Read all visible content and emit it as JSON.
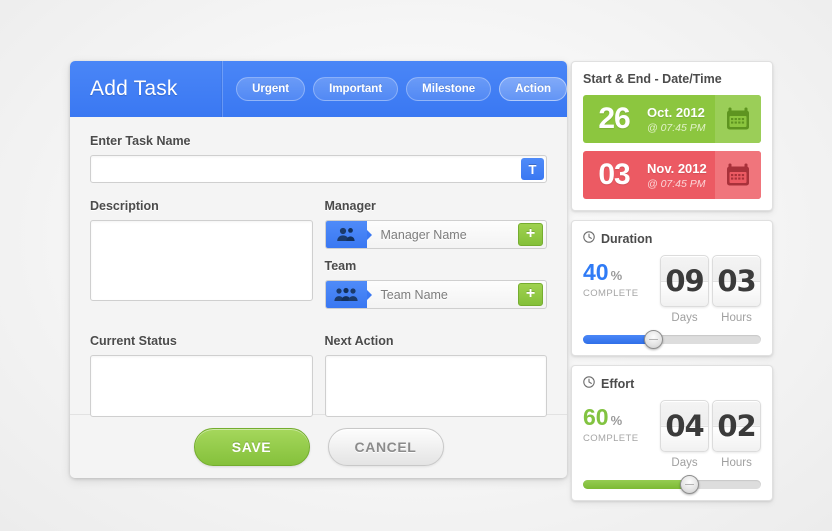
{
  "window": {
    "title": "Add Task",
    "tags": [
      {
        "label": "Urgent",
        "selected": false
      },
      {
        "label": "Important",
        "selected": false
      },
      {
        "label": "Milestone",
        "selected": false
      },
      {
        "label": "Action",
        "selected": true
      }
    ]
  },
  "form": {
    "task_name": {
      "label": "Enter Task Name",
      "value": "",
      "placeholder": "",
      "icon": "text-format-icon",
      "icon_glyph": "T"
    },
    "description": {
      "label": "Description",
      "value": "",
      "placeholder": ""
    },
    "manager": {
      "label": "Manager",
      "value": "Manager Name",
      "avatar_icon": "single-person-icon",
      "add_label": "+"
    },
    "team": {
      "label": "Team",
      "value": "Team Name",
      "avatar_icon": "group-people-icon",
      "add_label": "+"
    },
    "current_status": {
      "label": "Current Status",
      "value": "",
      "placeholder": ""
    },
    "next_action": {
      "label": "Next Action",
      "value": "",
      "placeholder": ""
    }
  },
  "footer": {
    "save_label": "SAVE",
    "cancel_label": "CANCEL"
  },
  "side_panel": {
    "dates_card": {
      "title": "Start & End - Date/Time",
      "rows": [
        {
          "kind": "start",
          "day": "26",
          "month_year": "Oct. 2012",
          "time": "@ 07:45 PM",
          "icon": "calendar-icon",
          "color": "#8cc63f"
        },
        {
          "kind": "end",
          "day": "03",
          "month_year": "Nov. 2012",
          "time": "@ 07:45 PM",
          "icon": "calendar-icon",
          "color": "#ec5a63"
        }
      ]
    },
    "duration_card": {
      "title": "Duration",
      "icon": "clock-icon",
      "percent": "40",
      "percent_sign": "%",
      "complete_label": "COMPLETE",
      "accent_color": "#2f7bf6",
      "units": [
        {
          "value": "09",
          "label": "Days"
        },
        {
          "value": "03",
          "label": "Hours"
        }
      ],
      "slider_percent": 40
    },
    "effort_card": {
      "title": "Effort",
      "icon": "clock-icon",
      "percent": "60",
      "percent_sign": "%",
      "complete_label": "COMPLETE",
      "accent_color": "#82c341",
      "units": [
        {
          "value": "04",
          "label": "Days"
        },
        {
          "value": "02",
          "label": "Hours"
        }
      ],
      "slider_percent": 60
    }
  }
}
